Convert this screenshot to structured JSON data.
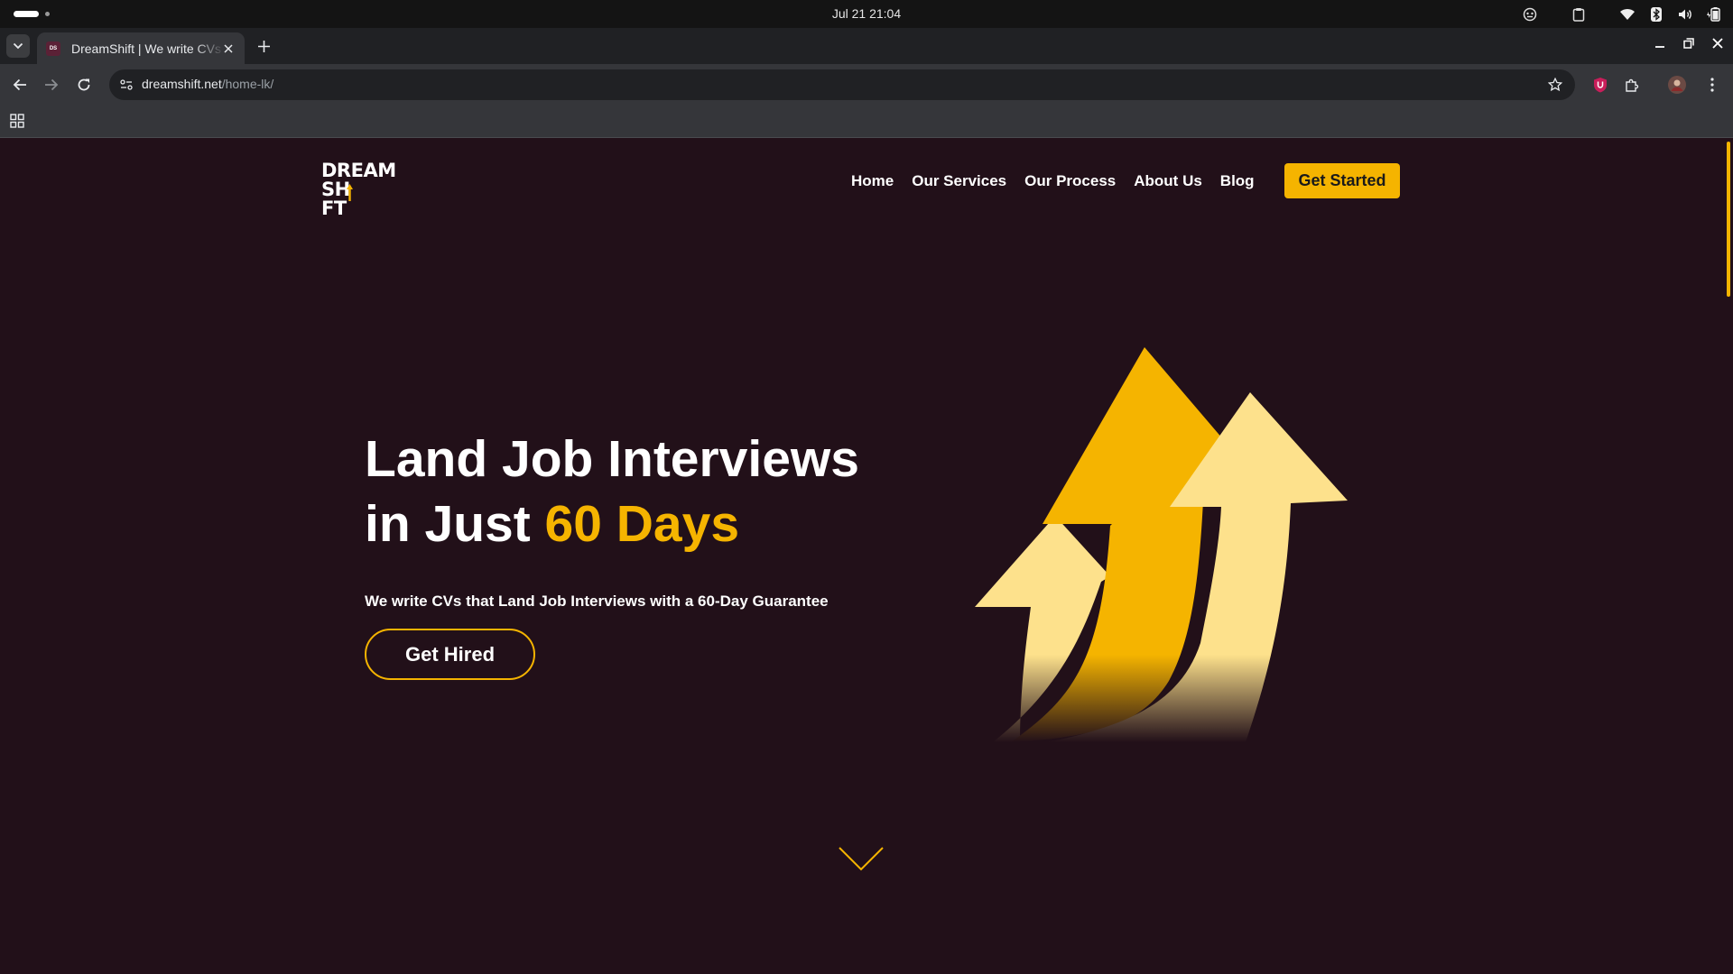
{
  "system": {
    "clock": "Jul 21  21:04"
  },
  "browser": {
    "tab": {
      "title": "DreamShift | We write CVs that Land Job Interviews",
      "favicon_text": "DS"
    },
    "url": {
      "host": "dreamshift.net",
      "path": "/home-lk/"
    }
  },
  "site": {
    "logo": {
      "line1": "DREAM",
      "line2_a": "SH",
      "line2_b": "FT"
    },
    "nav": [
      "Home",
      "Our Services",
      "Our Process",
      "About Us",
      "Blog"
    ],
    "cta_label": "Get Started",
    "hero": {
      "headline_line1": "Land Job Interviews",
      "headline_line2_prefix": "in Just ",
      "headline_highlight": "60 Days",
      "subheadline": "We write CVs that Land Job Interviews with a 60-Day Guarantee",
      "button_label": "Get Hired"
    }
  },
  "colors": {
    "page_bg": "#221019",
    "accent": "#f5b400",
    "arrow_light": "#fde18c",
    "browser_frame": "#35363a"
  }
}
